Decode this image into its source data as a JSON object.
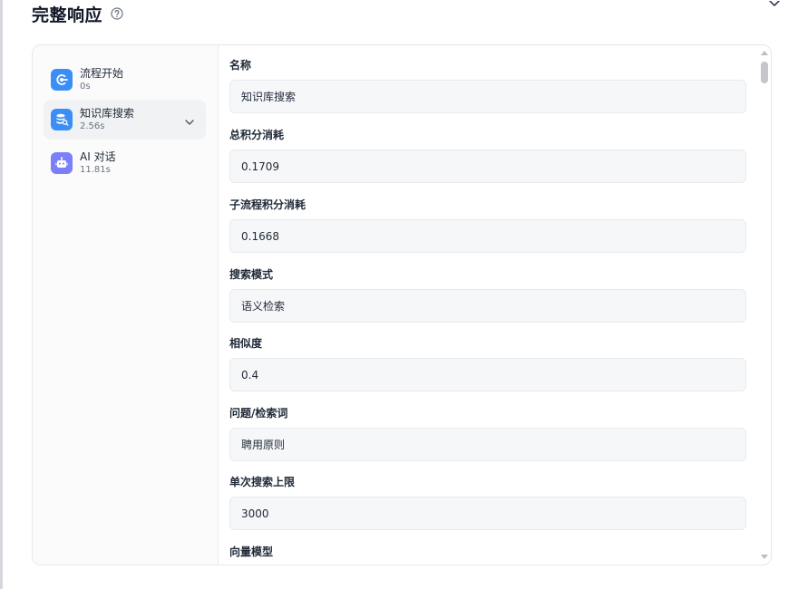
{
  "modal": {
    "title": "完整响应",
    "icons": {
      "help": "help-circle-icon",
      "close": "close-icon"
    }
  },
  "nodes": [
    {
      "name": "流程开始",
      "time": "0s",
      "icon": "play-circle-icon",
      "color": "#3b8ef5",
      "active": false
    },
    {
      "name": "知识库搜索",
      "time": "2.56s",
      "icon": "database-search-icon",
      "color": "#3b8ef5",
      "active": true,
      "expanded": true
    },
    {
      "name": "AI 对话",
      "time": "11.81s",
      "icon": "robot-icon",
      "color": "#7b80f8",
      "active": false
    }
  ],
  "fields": [
    {
      "label": "名称",
      "value": "知识库搜索"
    },
    {
      "label": "总积分消耗",
      "value": "0.1709"
    },
    {
      "label": "子流程积分消耗",
      "value": "0.1668"
    },
    {
      "label": "搜索模式",
      "value": "语义检索"
    },
    {
      "label": "相似度",
      "value": "0.4"
    },
    {
      "label": "问题/检索词",
      "value": "聘用原则"
    },
    {
      "label": "单次搜索上限",
      "value": "3000"
    },
    {
      "label": "向量模型",
      "value": ""
    }
  ],
  "colors": {
    "accent": "#3b8ef5",
    "ai_accent": "#7b80f8",
    "field_bg": "#f6f7f9"
  }
}
